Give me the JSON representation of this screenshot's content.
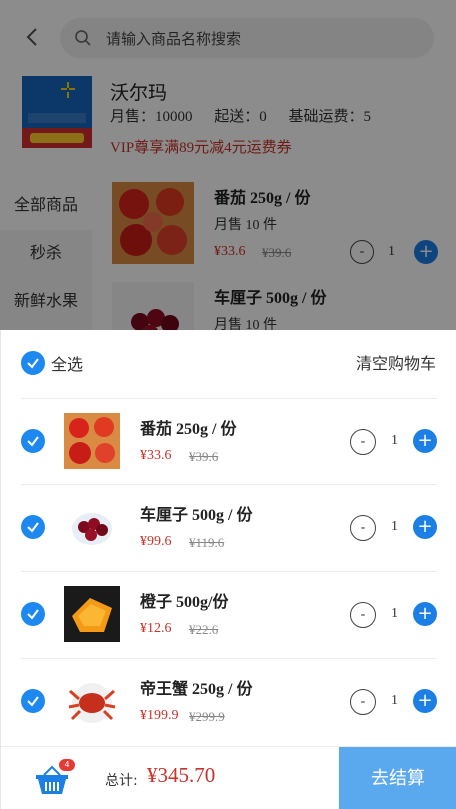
{
  "search": {
    "placeholder": "请输入商品名称搜索"
  },
  "store": {
    "name": "沃尔玛",
    "sales": "月售：10000",
    "delivery_min": "起送：0",
    "base_fee": "基础运费：5",
    "coupon": "VIP尊享满89元减4元运费券"
  },
  "categories": [
    "全部商品",
    "秒杀",
    "新鲜水果"
  ],
  "products": [
    {
      "title": "番茄 250g / 份",
      "sales": "月售 10 件",
      "price": "¥33.6",
      "old_price": "¥39.6",
      "qty": "1"
    },
    {
      "title": "车厘子 500g / 份",
      "sales": "月售 10 件"
    }
  ],
  "cart": {
    "select_all": "全选",
    "clear": "清空购物车",
    "items": [
      {
        "title": "番茄 250g / 份",
        "price": "¥33.6",
        "old_price": "¥39.6",
        "qty": "1"
      },
      {
        "title": "车厘子 500g / 份",
        "price": "¥99.6",
        "old_price": "¥119.6",
        "qty": "1"
      },
      {
        "title": "橙子 500g/份",
        "price": "¥12.6",
        "old_price": "¥22.6",
        "qty": "1"
      },
      {
        "title": "帝王蟹 250g / 份",
        "price": "¥199.9",
        "old_price": "¥299.9",
        "qty": "1"
      }
    ],
    "minus_label": "-",
    "plus_label": "+",
    "badge_count": "4",
    "total_label": "总计:",
    "total_value": "¥345.70",
    "checkout": "去结算"
  },
  "colors": {
    "accent": "#1d89f0",
    "price": "#c9322b",
    "checkout": "#5aa9ef"
  }
}
